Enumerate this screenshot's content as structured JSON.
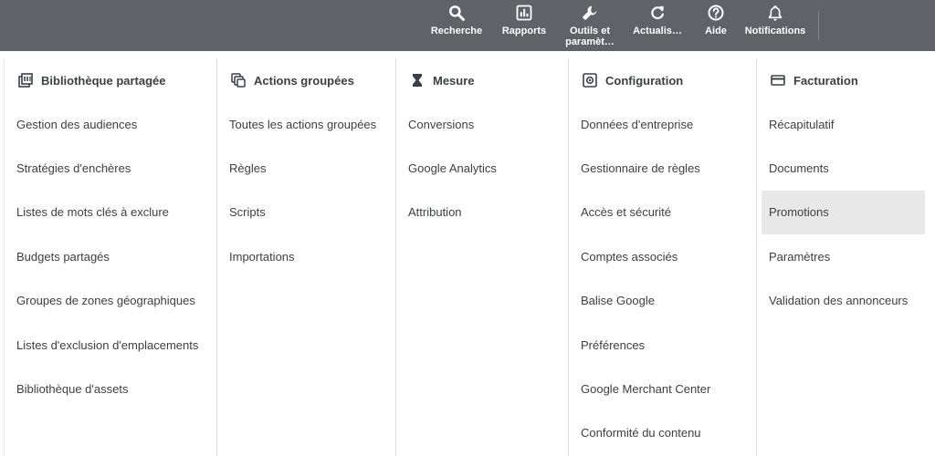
{
  "toolbar": {
    "search_label": "Recherche",
    "reports_label": "Rapports",
    "tools_label": "Outils et paramèt…",
    "refresh_label": "Actualis…",
    "help_label": "Aide",
    "notifications_label": "Notifications"
  },
  "columns": [
    {
      "title": "Bibliothèque partagée",
      "icon": "library-icon",
      "items": [
        "Gestion des audiences",
        "Stratégies d'enchères",
        "Listes de mots clés à exclure",
        "Budgets partagés",
        "Groupes de zones géographiques",
        "Listes d'exclusion d'emplacements",
        "Bibliothèque d'assets"
      ]
    },
    {
      "title": "Actions groupées",
      "icon": "bulk-actions-icon",
      "items": [
        "Toutes les actions groupées",
        "Règles",
        "Scripts",
        "Importations"
      ]
    },
    {
      "title": "Mesure",
      "icon": "hourglass-icon",
      "items": [
        "Conversions",
        "Google Analytics",
        "Attribution"
      ]
    },
    {
      "title": "Configuration",
      "icon": "settings-box-icon",
      "items": [
        "Données d'entreprise",
        "Gestionnaire de règles",
        "Accès et sécurité",
        "Comptes associés",
        "Balise Google",
        "Préférences",
        "Google Merchant Center",
        "Conformité du contenu"
      ]
    },
    {
      "title": "Facturation",
      "icon": "credit-card-icon",
      "items": [
        "Récapitulatif",
        "Documents",
        "Promotions",
        "Paramètres",
        "Validation des annonceurs"
      ],
      "highlighted": "Promotions"
    }
  ],
  "colors": {
    "topbar": "#5f6368",
    "highlight": "#e8e8e8"
  }
}
